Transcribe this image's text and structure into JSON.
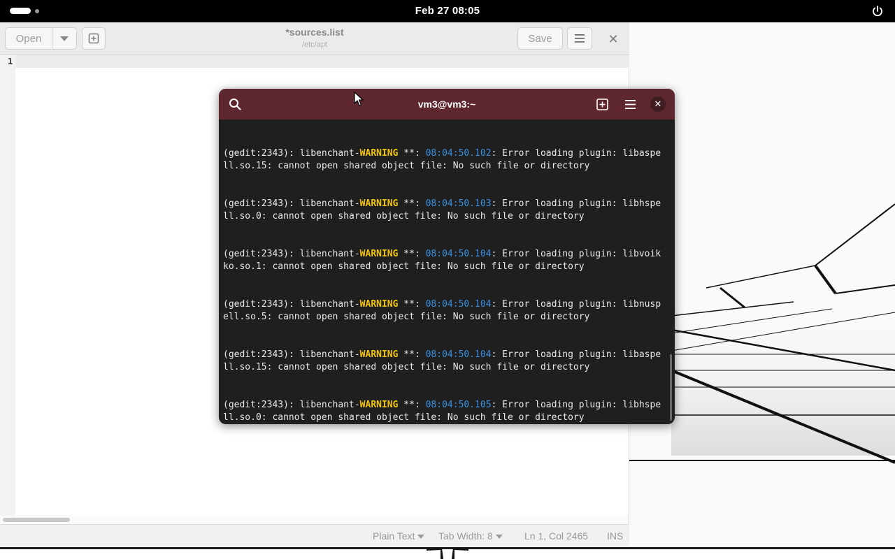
{
  "topbar": {
    "clock": "Feb 27  08:05",
    "power_icon": "power-icon"
  },
  "gedit": {
    "open_label": "Open",
    "save_label": "Save",
    "title": "*sources.list",
    "subtitle": "/etc/apt",
    "line_number": "1",
    "statusbar": {
      "language": "Plain Text",
      "tab_width": "Tab Width: 8",
      "position": "Ln 1, Col 2465",
      "mode": "INS"
    }
  },
  "terminal": {
    "title": "vm3@vm3:~",
    "accent_color": "#5e2730",
    "entries": [
      {
        "prefix": "(gedit:2343): libenchant-",
        "level": "WARNING",
        "mid": " **: ",
        "time": "08:04:50.102",
        "rest": ": Error loading plugin: libaspe",
        "cont": "ll.so.15: cannot open shared object file: No such file or directory"
      },
      {
        "prefix": "(gedit:2343): libenchant-",
        "level": "WARNING",
        "mid": " **: ",
        "time": "08:04:50.103",
        "rest": ": Error loading plugin: libhspe",
        "cont": "ll.so.0: cannot open shared object file: No such file or directory"
      },
      {
        "prefix": "(gedit:2343): libenchant-",
        "level": "WARNING",
        "mid": " **: ",
        "time": "08:04:50.104",
        "rest": ": Error loading plugin: libvoik",
        "cont": "ko.so.1: cannot open shared object file: No such file or directory"
      },
      {
        "prefix": "(gedit:2343): libenchant-",
        "level": "WARNING",
        "mid": " **: ",
        "time": "08:04:50.104",
        "rest": ": Error loading plugin: libnusp",
        "cont": "ell.so.5: cannot open shared object file: No such file or directory"
      },
      {
        "prefix": "(gedit:2343): libenchant-",
        "level": "WARNING",
        "mid": " **: ",
        "time": "08:04:50.104",
        "rest": ": Error loading plugin: libaspe",
        "cont": "ll.so.15: cannot open shared object file: No such file or directory"
      },
      {
        "prefix": "(gedit:2343): libenchant-",
        "level": "WARNING",
        "mid": " **: ",
        "time": "08:04:50.105",
        "rest": ": Error loading plugin: libhspe",
        "cont": "ll.so.0: cannot open shared object file: No such file or directory"
      }
    ]
  }
}
